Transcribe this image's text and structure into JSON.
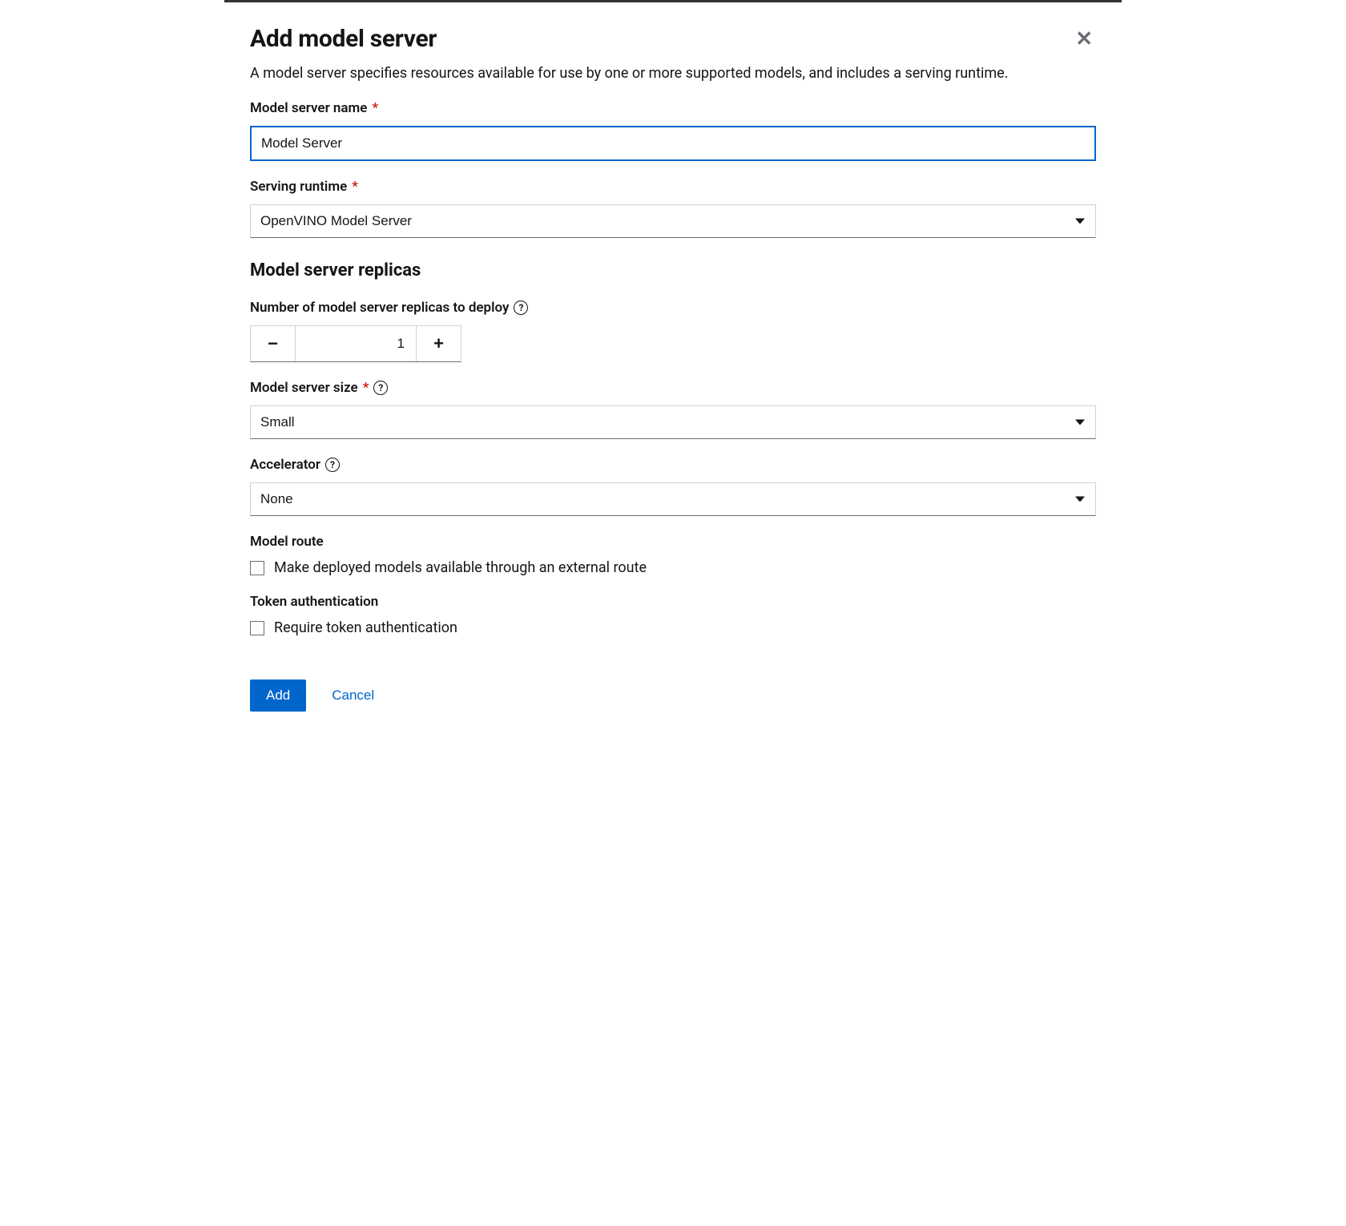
{
  "modal": {
    "title": "Add model server",
    "subtitle": "A model server specifies resources available for use by one or more supported models, and includes a serving runtime."
  },
  "form": {
    "server_name": {
      "label": "Model server name",
      "value": "Model Server"
    },
    "serving_runtime": {
      "label": "Serving runtime",
      "value": "OpenVINO Model Server"
    },
    "replicas_section": {
      "heading": "Model server replicas",
      "label": "Number of model server replicas to deploy",
      "value": "1"
    },
    "server_size": {
      "label": "Model server size",
      "value": "Small"
    },
    "accelerator": {
      "label": "Accelerator",
      "value": "None"
    },
    "model_route": {
      "label": "Model route",
      "checkbox_label": "Make deployed models available through an external route"
    },
    "token_auth": {
      "label": "Token authentication",
      "checkbox_label": "Require token authentication"
    }
  },
  "footer": {
    "add_label": "Add",
    "cancel_label": "Cancel"
  }
}
